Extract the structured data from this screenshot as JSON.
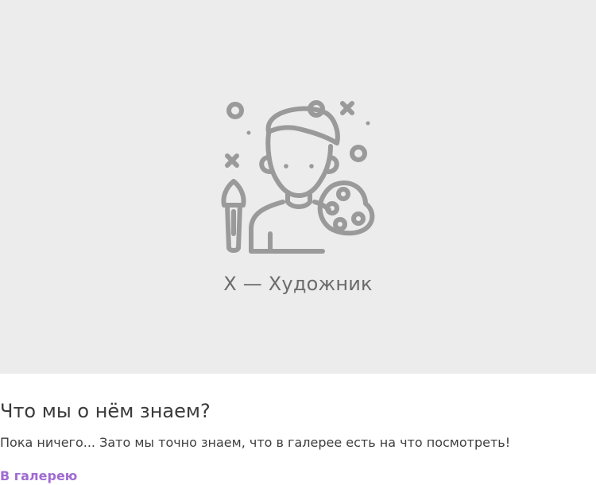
{
  "hero": {
    "illustration_icon": "artist-with-brush-and-palette-icon",
    "caption": "X — Художник"
  },
  "section": {
    "title": "Что мы о нём знаем?",
    "text": "Пока ничего... Зато мы точно знаем, что в галерее есть на что посмотреть!",
    "link_label": "В галерею"
  },
  "colors": {
    "hero_background": "#ececed",
    "illustration_stroke": "#9a9a9a",
    "caption_text": "#6b6b6b",
    "link_accent": "#a06ad1"
  }
}
